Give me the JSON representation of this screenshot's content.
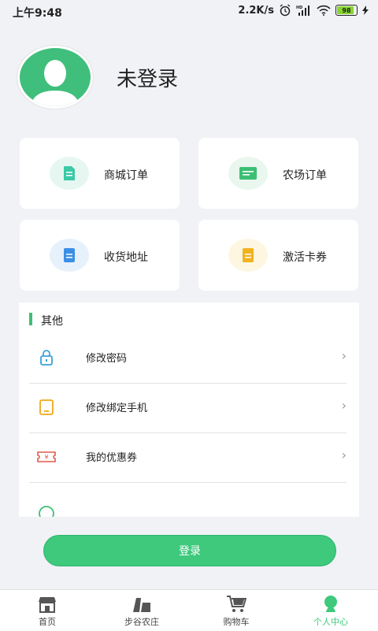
{
  "status_bar": {
    "time": "上午9:48",
    "network_speed": "2.2K/s",
    "battery": "98"
  },
  "profile": {
    "username": "未登录"
  },
  "cards": [
    {
      "label": "商城订单",
      "icon": "mall-order-icon",
      "color": "#3cc9a6",
      "bg": "#e6f7f1"
    },
    {
      "label": "农场订单",
      "icon": "farm-order-icon",
      "color": "#3dbf73",
      "bg": "#e9f7ee"
    },
    {
      "label": "收货地址",
      "icon": "address-icon",
      "color": "#3b8fe6",
      "bg": "#e6f1fc"
    },
    {
      "label": "激活卡券",
      "icon": "activate-coupon-icon",
      "color": "#f2b320",
      "bg": "#fdf7e2"
    }
  ],
  "other": {
    "title": "其他",
    "items": [
      {
        "label": "修改密码",
        "icon": "lock-icon"
      },
      {
        "label": "修改绑定手机",
        "icon": "phone-icon"
      },
      {
        "label": "我的优惠券",
        "icon": "coupon-icon"
      }
    ]
  },
  "login_button": "登录",
  "tabbar": [
    {
      "label": "首页",
      "icon": "home-shop-icon",
      "active": false
    },
    {
      "label": "步谷农庄",
      "icon": "farm-icon",
      "active": false
    },
    {
      "label": "购物车",
      "icon": "cart-icon",
      "active": false
    },
    {
      "label": "个人中心",
      "icon": "person-icon",
      "active": true
    }
  ],
  "colors": {
    "accent": "#3ec97c",
    "background": "#f1f2f6"
  }
}
